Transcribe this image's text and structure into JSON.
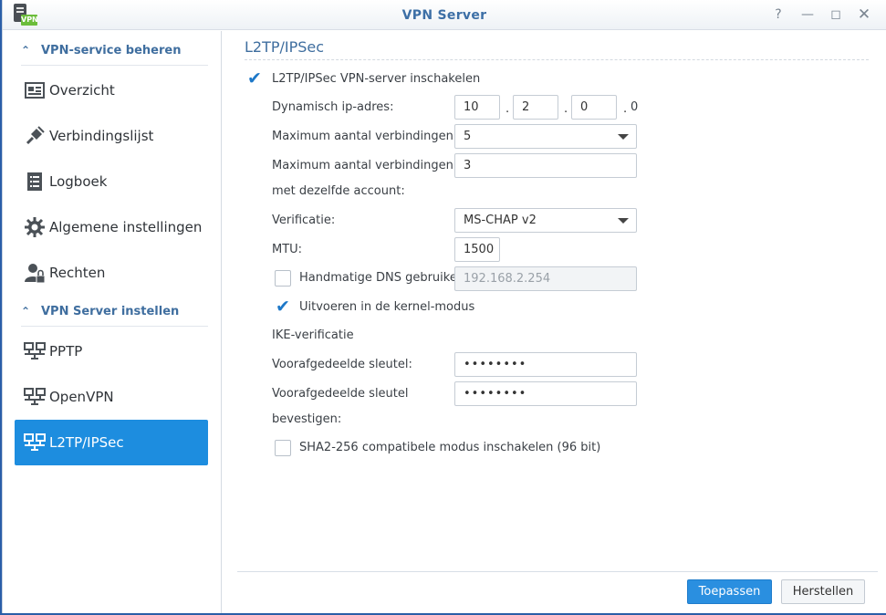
{
  "window": {
    "title": "VPN Server",
    "app_badge": "VPN"
  },
  "sidebar": {
    "sections": [
      {
        "label": "VPN-service beheren"
      },
      {
        "label": "VPN Server instellen"
      }
    ],
    "items": [
      {
        "label": "Overzicht",
        "icon": "overview-icon"
      },
      {
        "label": "Verbindingslijst",
        "icon": "connection-list-icon"
      },
      {
        "label": "Logboek",
        "icon": "log-icon"
      },
      {
        "label": "Algemene instellingen",
        "icon": "gear-icon"
      },
      {
        "label": "Rechten",
        "icon": "user-lock-icon"
      },
      {
        "label": "PPTP",
        "icon": "network-icon"
      },
      {
        "label": "OpenVPN",
        "icon": "network-icon"
      },
      {
        "label": "L2TP/IPSec",
        "icon": "network-icon",
        "active": true
      }
    ]
  },
  "main": {
    "title": "L2TP/IPSec",
    "enable_label": "L2TP/IPSec VPN-server inschakelen",
    "dynamic_ip_label": "Dynamisch ip-adres:",
    "ip": {
      "o1": "10",
      "o2": "2",
      "o3": "0",
      "o4": "0",
      "sep": "."
    },
    "max_conn_label": "Maximum aantal verbindingen:",
    "max_conn_value": "5",
    "max_conn_account_label_1": "Maximum aantal verbindingen",
    "max_conn_account_label_2": "met dezelfde account:",
    "max_conn_account_value": "3",
    "auth_label": "Verificatie:",
    "auth_value": "MS-CHAP v2",
    "mtu_label": "MTU:",
    "mtu_value": "1500",
    "dns_label": "Handmatige DNS gebruiken",
    "dns_value": "192.168.2.254",
    "kernel_label": "Uitvoeren in de kernel-modus",
    "ike_label": "IKE-verificatie",
    "psk_label": "Voorafgedeelde sleutel:",
    "psk_value": "••••••••",
    "psk_confirm_label_1": "Voorafgedeelde sleutel",
    "psk_confirm_label_2": "bevestigen:",
    "psk_confirm_value": "••••••••",
    "sha_label": "SHA2-256 compatibele modus inschakelen (96 bit)"
  },
  "footer": {
    "apply_label": "Toepassen",
    "reset_label": "Herstellen"
  },
  "colors": {
    "accent": "#1d8ddf",
    "heading": "#3f6e9f"
  }
}
